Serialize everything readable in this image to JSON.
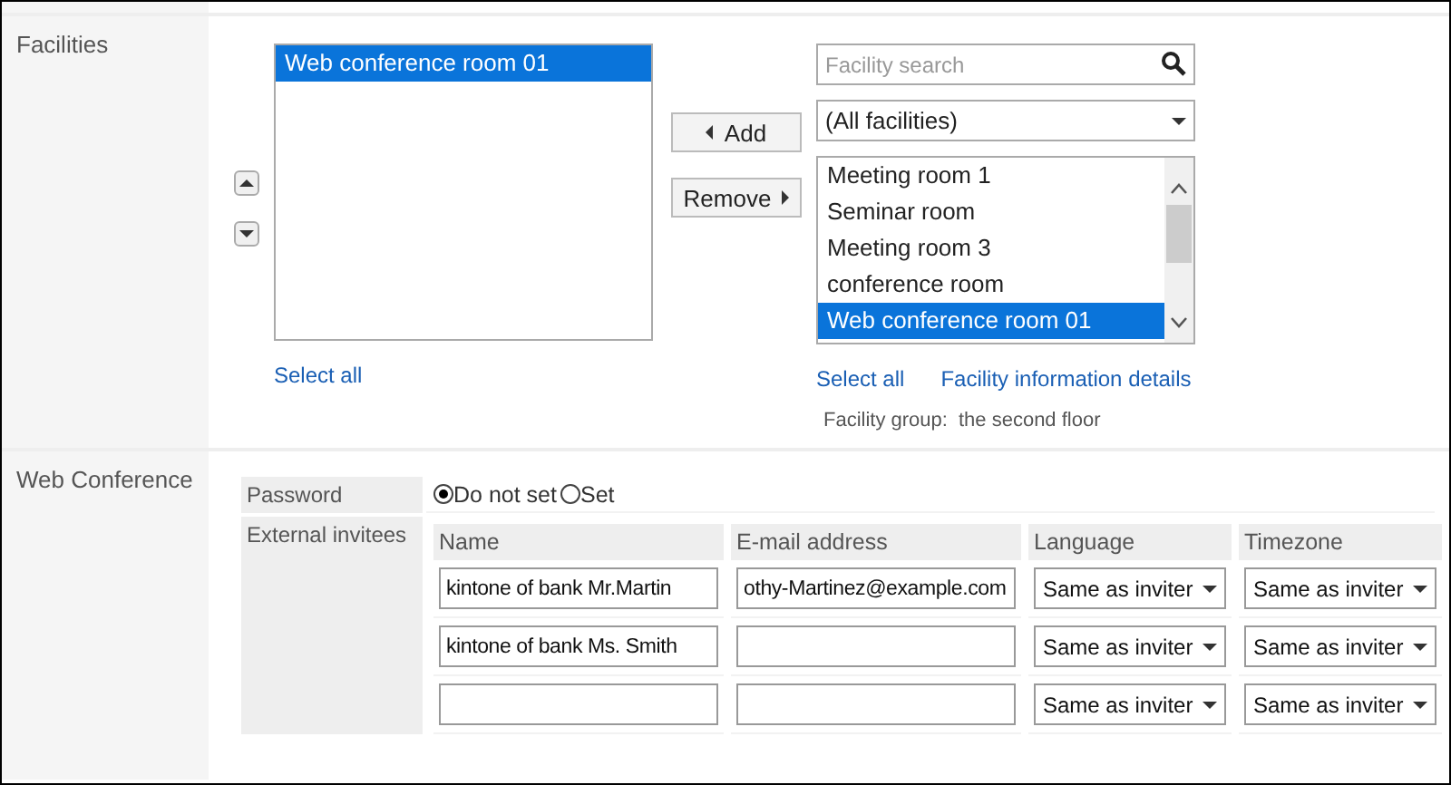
{
  "facilities": {
    "label": "Facilities",
    "selected_list": {
      "items": [
        {
          "name": "Web conference room 01",
          "selected": true
        }
      ],
      "select_all": "Select all"
    },
    "add_button": "Add",
    "remove_button": "Remove",
    "search": {
      "placeholder": "Facility search"
    },
    "filter": {
      "value": "(All facilities)"
    },
    "available_list": {
      "items": [
        {
          "name": "Meeting room 1",
          "selected": false
        },
        {
          "name": "Seminar room",
          "selected": false
        },
        {
          "name": "Meeting room 3",
          "selected": false
        },
        {
          "name": "conference room",
          "selected": false
        },
        {
          "name": "Web conference room 01",
          "selected": true
        }
      ],
      "select_all": "Select all",
      "details_link": "Facility information details"
    },
    "group": {
      "label": "Facility group:",
      "value": "the second floor"
    }
  },
  "web_conference": {
    "label": "Web Conference",
    "password": {
      "label": "Password",
      "options": [
        {
          "label": "Do not set",
          "selected": true
        },
        {
          "label": "Set",
          "selected": false
        }
      ]
    },
    "external_invitees": {
      "label": "External invitees",
      "columns": [
        "Name",
        "E-mail address",
        "Language",
        "Timezone"
      ],
      "rows": [
        {
          "name": "kintone of bank Mr.Martin",
          "email": "othy-Martinez@example.com",
          "language": "Same as inviter",
          "timezone": "Same as inviter"
        },
        {
          "name": "kintone of bank Ms. Smith",
          "language": "Same as inviter",
          "timezone": "Same as inviter"
        },
        {
          "language": "Same as inviter",
          "timezone": "Same as inviter"
        }
      ]
    }
  }
}
